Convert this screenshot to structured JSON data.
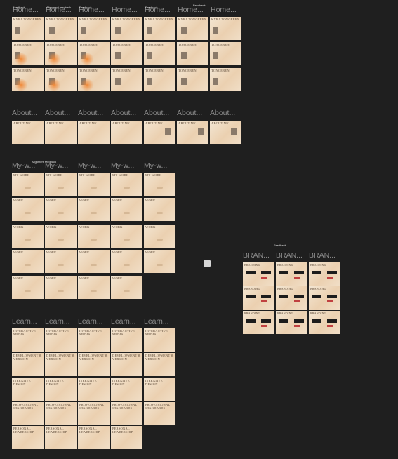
{
  "sections": {
    "home": {
      "label": "Home...",
      "frame_title": "KYRA TONGEREN",
      "frame_title_b": "TONGEREN"
    },
    "about": {
      "label": "About...",
      "frame_title": "ABOUT ME"
    },
    "work": {
      "label": "My-w...",
      "frame_title": "MY WORK",
      "frame_title_b": "WORK"
    },
    "learn": {
      "label": "Learn...",
      "rows": [
        "INTERACTIVE MEDIA",
        "DEVELOPMENT & VERSION",
        "ITERATIVE DESIGN",
        "PROFESSIONAL STANDARDS",
        "PERSONAL LEADERSHIP"
      ],
      "row_last": "PERSONAL LEADERSHIP"
    },
    "brand": {
      "label": "BRAN...",
      "frame_title": "BRANDING"
    }
  },
  "notes": {
    "feedback": "Feedback",
    "alignment": "Alignment feedback",
    "work_feedback": "Alignment feedback"
  },
  "colors": {
    "canvas": "#1f1f1f",
    "frame_light": "#f3e6d3",
    "frame_warm": "#ebd0b0",
    "accent_red": "#c04040",
    "accent_orange": "#f08a3a"
  }
}
